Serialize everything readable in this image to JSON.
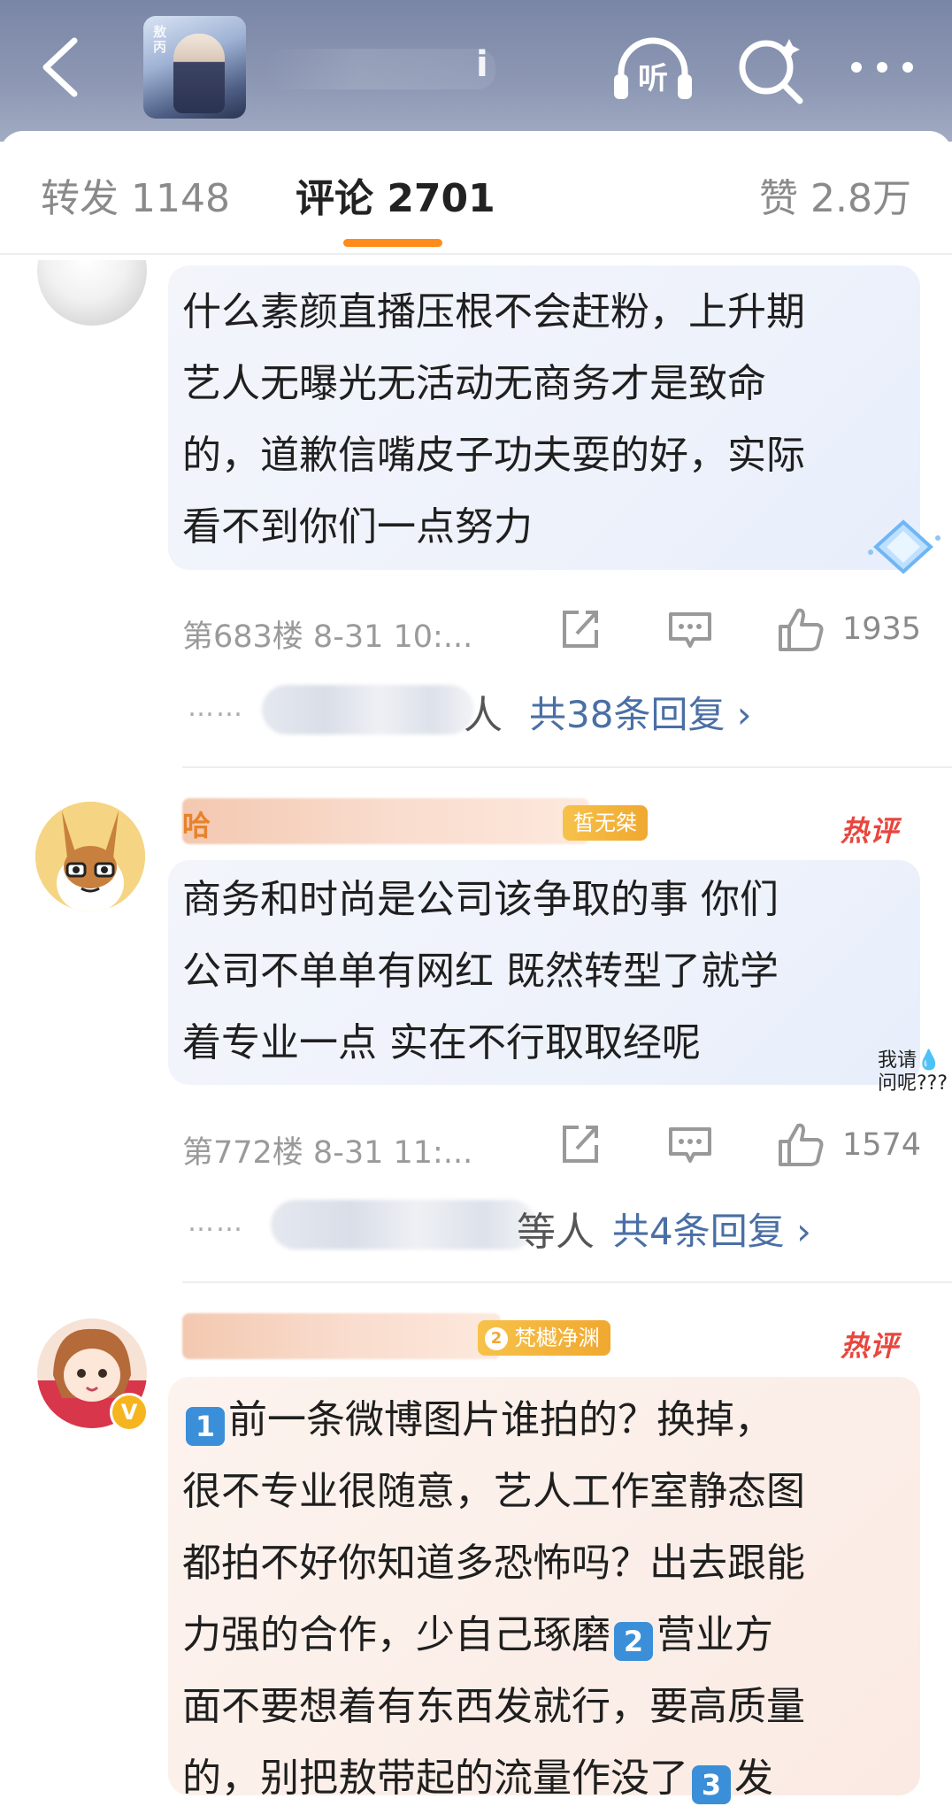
{
  "header": {
    "title_fragment": "i",
    "cover_text": "敖丙",
    "listen_label": "听"
  },
  "tabs": [
    {
      "label": "转发 1148"
    },
    {
      "label": "评论 2701"
    },
    {
      "label": "赞 2.8万"
    }
  ],
  "comments": [
    {
      "lines": [
        "什么素颜直播压根不会赶粉，上升期",
        "艺人无曝光无活动无商务才是致命",
        "的，道歉信嘴皮子功夫耍的好，实际",
        "看不到你们一点努力"
      ],
      "floor_time": "第683楼 8-31 10:...",
      "likes": "1935",
      "reply_tail": "人",
      "reply_count": "共38条回复 ›"
    },
    {
      "name_fragment": "哈",
      "badge": "皙无桀",
      "hot": "热评",
      "lines": [
        "商务和时尚是公司该争取的事 你们",
        "公司不单单有网红 既然转型了就学",
        "着专业一点 实在不行取取经呢"
      ],
      "sticker": [
        "我请💧",
        "问呢???"
      ],
      "floor_time": "第772楼 8-31 11:...",
      "likes": "1574",
      "reply_tail": "等人",
      "reply_count": "共4条回复 ›"
    },
    {
      "badge": "梵樾净渊",
      "badge_level": "2",
      "hot": "热评",
      "emoji1": "1",
      "emoji2": "2",
      "emoji3": "3",
      "line1": "前一条微博图片谁拍的？换掉，",
      "line2": "很不专业很随意，艺人工作室静态图",
      "line3": "都拍不好你知道多恐怖吗？出去跟能",
      "line4a": "力强的合作，少自己琢磨",
      "line4b": "营业方",
      "line5": "面不要想着有东西发就行，要高质量",
      "line6a": "的，别把敖带起的流量作没了",
      "line6b": "发",
      "verified": "V"
    }
  ],
  "dots": "……",
  "colors": {
    "accent_orange": "#ff8c1a",
    "link_blue": "#4a6fa5",
    "hot_red": "#e8463e",
    "header_blue": "#8d98b4"
  }
}
